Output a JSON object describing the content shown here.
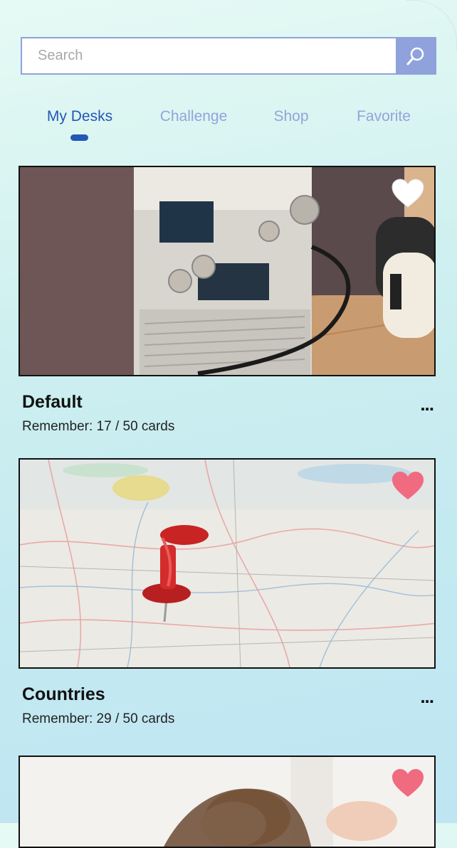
{
  "search": {
    "placeholder": "Search"
  },
  "tabs": [
    {
      "label": "My Desks"
    },
    {
      "label": "Challenge"
    },
    {
      "label": "Shop"
    },
    {
      "label": "Favorite"
    }
  ],
  "active_tab": "My Desks",
  "decks": [
    {
      "title": "Default",
      "remember": "Remember: 17 / 50 cards",
      "more": "...",
      "favorite": false
    },
    {
      "title": "Countries",
      "remember": "Remember: 29 / 50 cards",
      "more": "...",
      "favorite": true
    },
    {
      "favorite": true
    }
  ],
  "colors": {
    "accent": "#2457b6",
    "tab_inactive": "#93a4db",
    "search_border": "#8fa2dc",
    "heart_favorite": "#f06b80",
    "heart_default": "#ffffff"
  },
  "icons": {
    "search": "search-icon",
    "heart": "heart-icon",
    "more": "more-icon"
  }
}
